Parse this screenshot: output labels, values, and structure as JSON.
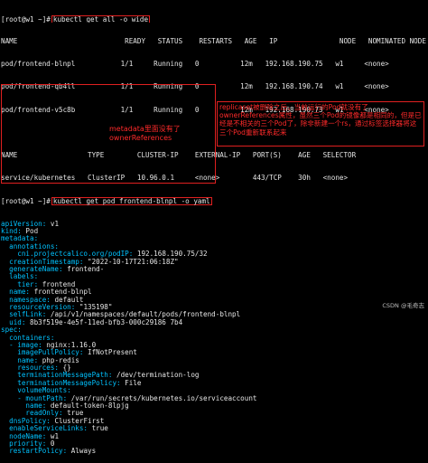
{
  "prompt": "[root@w1 ~]#",
  "cmd1": "kubectl get all -o wide",
  "pods_header": "NAME                          READY   STATUS    RESTARTS   AGE   IP               NODE   NOMINATED NODE   READINESS GATES",
  "pods": [
    "pod/frontend-blnpl           1/1     Running   0          12m   192.168.190.75   w1     <none>           <none>",
    "pod/frontend-qb4ll           1/1     Running   0          12m   192.168.190.74   w1     <none>           <none>",
    "pod/frontend-v5c8b           1/1     Running   0          12m   192.168.190.73   w1     <none>           <none>"
  ],
  "svc_header": "NAME                 TYPE        CLUSTER-IP    EXTERNAL-IP   PORT(S)    AGE   SELECTOR",
  "svc": "service/kubernetes   ClusterIP   10.96.0.1     <none>        443/TCP    30h   <none>",
  "cmd2": "kubectl get pod frontend-blnpl -o yaml",
  "yaml": [
    {
      "k": "apiVersion:",
      "v": " v1"
    },
    {
      "k": "kind:",
      "v": " Pod"
    },
    {
      "k": "metadata:",
      "v": ""
    },
    {
      "k": "  annotations:",
      "v": ""
    },
    {
      "k": "    cni.projectcalico.org/podIP:",
      "v": " 192.168.190.75/32"
    },
    {
      "k": "  creationTimestamp:",
      "v": " \"2022-10-17T21:06:18Z\""
    },
    {
      "k": "  generateName:",
      "v": " frontend-"
    },
    {
      "k": "  labels:",
      "v": ""
    },
    {
      "k": "    tier:",
      "v": " frontend"
    },
    {
      "k": "  name:",
      "v": " frontend-blnpl"
    },
    {
      "k": "  namespace:",
      "v": " default"
    },
    {
      "k": "  resourceVersion:",
      "v": " \"135198\""
    },
    {
      "k": "  selfLink:",
      "v": " /api/v1/namespaces/default/pods/frontend-blnpl"
    },
    {
      "k": "  uid:",
      "v": " 8b3f519e-4e5f-11ed-bfb3-000c29186 7b4"
    },
    {
      "k": "spec:",
      "v": ""
    },
    {
      "k": "  containers:",
      "v": ""
    },
    {
      "k": "  - image:",
      "v": " nginx:1.16.0"
    },
    {
      "k": "    imagePullPolicy:",
      "v": " IfNotPresent"
    },
    {
      "k": "    name:",
      "v": " php-redis"
    },
    {
      "k": "    resources:",
      "v": " {}"
    },
    {
      "k": "    terminationMessagePath:",
      "v": " /dev/termination-log"
    },
    {
      "k": "    terminationMessagePolicy:",
      "v": " File"
    },
    {
      "k": "    volumeMounts:",
      "v": ""
    },
    {
      "k": "    - mountPath:",
      "v": " /var/run/secrets/kubernetes.io/serviceaccount"
    },
    {
      "k": "      name:",
      "v": " default-token-8lpjg"
    },
    {
      "k": "      readOnly:",
      "v": " true"
    },
    {
      "k": "  dnsPolicy:",
      "v": " ClusterFirst"
    },
    {
      "k": "  enableServiceLinks:",
      "v": " true"
    },
    {
      "k": "  nodeName:",
      "v": " w1"
    },
    {
      "k": "  priority:",
      "v": " 0"
    },
    {
      "k": "  restartPolicy:",
      "v": " Always"
    }
  ],
  "anno_meta": "metadata里面没有了ownerReferences",
  "anno_main": "replicaset被删除之后，当前运行的Pod就没有了ownerReferences属性，虽然三个Pod的镜像都是相同的，但是已经是不相关的三个Pod了，除非新建一个rs，通过标签选择器将这三个Pod重新联系起来",
  "watermark": "CSDN @毛奇志"
}
